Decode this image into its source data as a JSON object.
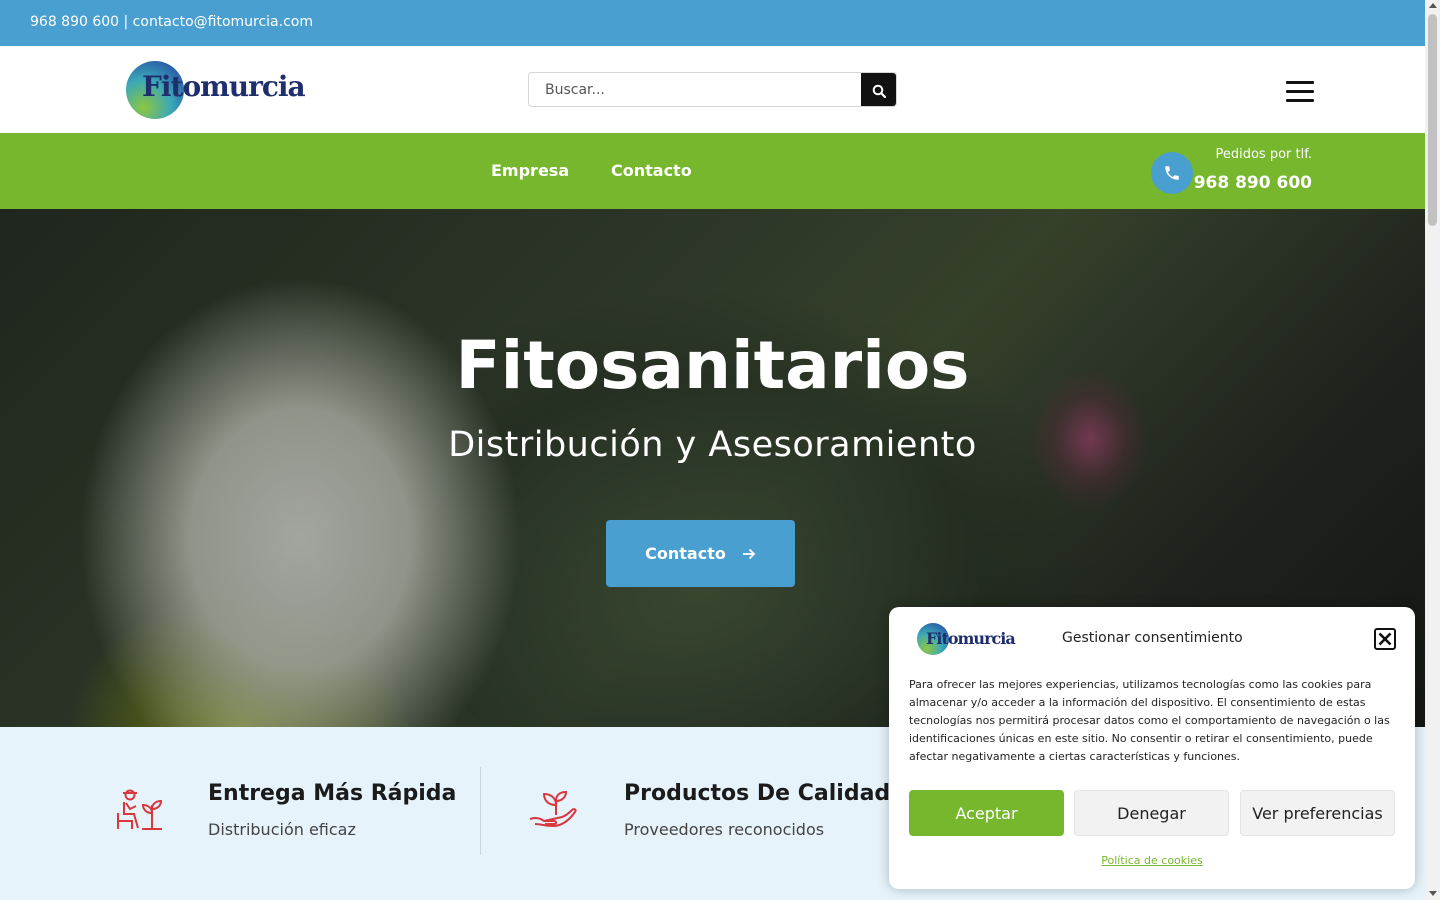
{
  "topbar": {
    "contact_text": "968 890 600 | contacto@fitomurcia.com"
  },
  "header": {
    "logo_prefix": "Fito",
    "logo_suffix": "murcia",
    "search_placeholder": "Buscar...",
    "search_icon": "search-icon",
    "menu_icon": "hamburger-icon"
  },
  "nav": {
    "items": [
      {
        "label": "Empresa"
      },
      {
        "label": "Contacto"
      }
    ],
    "phone_caption": "Pedidos por tlf.",
    "phone_number": "968 890 600",
    "phone_icon": "phone-icon"
  },
  "hero": {
    "title": "Fitosanitarios",
    "subtitle": "Distribución y Asesoramiento",
    "cta_label": "Contacto",
    "cta_icon": "arrow-right-icon"
  },
  "features": [
    {
      "title": "Entrega Más Rápida",
      "subtitle": "Distribución eficaz",
      "icon": "worker-plant-icon"
    },
    {
      "title": "Productos De Calidad",
      "subtitle": "Proveedores reconocidos",
      "icon": "hand-sprout-icon"
    }
  ],
  "cookie": {
    "logo_prefix": "Fito",
    "logo_suffix": "murcia",
    "title": "Gestionar consentimiento",
    "text": "Para ofrecer las mejores experiencias, utilizamos tecnologías como las cookies para almacenar y/o acceder a la información del dispositivo. El consentimiento de estas tecnologías nos permitirá procesar datos como el comportamiento de navegación o las identificaciones únicas en este sitio. No consentir o retirar el consentimiento, puede afectar negativamente a ciertas características y funciones.",
    "accept_label": "Aceptar",
    "deny_label": "Denegar",
    "prefs_label": "Ver preferencias",
    "policy_link": "Política de cookies"
  },
  "colors": {
    "brand_blue": "#4a9fd1",
    "brand_green": "#76b72d",
    "feature_icon": "#d9363e"
  }
}
